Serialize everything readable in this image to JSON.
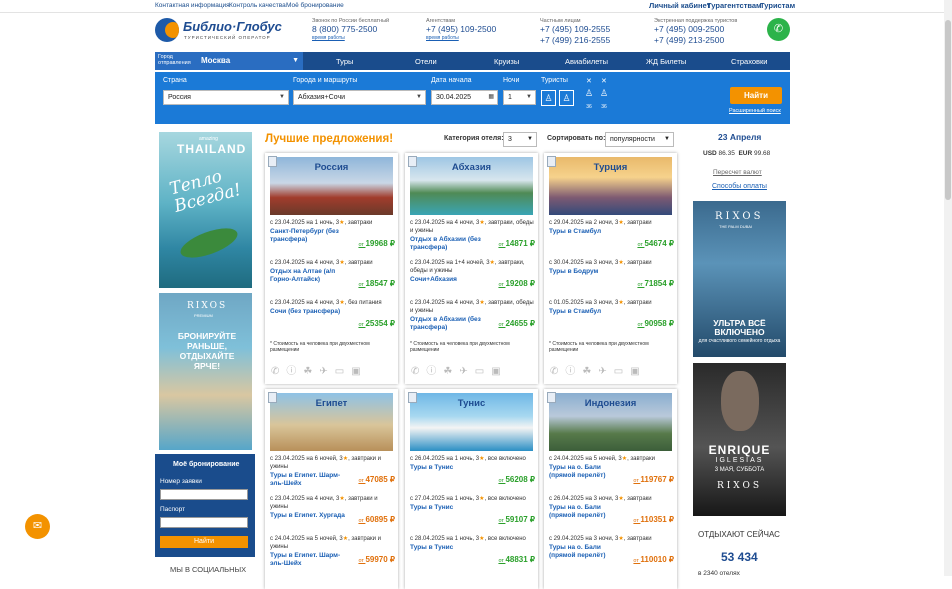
{
  "topbar": {
    "left": [
      "Контактная информация",
      "Контроль качества",
      "Моё бронирование"
    ],
    "right": [
      "Личный кабинет",
      "Турагентствам",
      "Туристам"
    ]
  },
  "logo": {
    "name": "Библио·Глобус",
    "sub": "ТУРИСТИЧЕСКИЙ ОПЕРАТОР"
  },
  "phones": [
    {
      "caption": "Звонок по России бесплатный",
      "nums": [
        "8 (800) 775-2500"
      ],
      "link": "время работы"
    },
    {
      "caption": "Агентствам",
      "nums": [
        "+7 (495) 109-2500"
      ],
      "link": "время работы"
    },
    {
      "caption": "Частным лицам",
      "nums": [
        "+7 (495) 109-2555",
        "+7 (499) 216-2555"
      ],
      "link": ""
    },
    {
      "caption": "Экстренная поддержка туристов",
      "nums": [
        "+7 (495) 009-2500",
        "+7 (499) 213-2500"
      ],
      "link": ""
    }
  ],
  "nav": {
    "city_label": "Город отправления",
    "city": "Москва",
    "items": [
      "Туры",
      "Отели",
      "Круизы",
      "Авиабилеты",
      "ЖД Билеты",
      "Страховки"
    ]
  },
  "search": {
    "country_label": "Страна",
    "country": "Россия",
    "city_label": "Города и маршруты",
    "city": "Абхазия+Сочи",
    "date_label": "Дата начала",
    "date": "30.04.2025",
    "nights_label": "Ночи",
    "nights": "1",
    "tourists_label": "Туристы",
    "kid_age_1": "36",
    "kid_age_2": "36",
    "find": "Найти",
    "advanced": "Расширенный поиск"
  },
  "best": {
    "title": "Лучшие предложения!",
    "cat_label": "Категория отеля:",
    "cat": "3",
    "sort_label": "Сортировать по:",
    "sort": "популярности"
  },
  "cards": [
    {
      "title": "Россия",
      "offers": [
        {
          "date": "с 23.04.2025",
          "nights": "на 1 ночь,",
          "stars": "3",
          "meal": "завтраки",
          "name": "Санкт-Петербург (без трансфера)",
          "from": "от",
          "price": "19968"
        },
        {
          "date": "с 23.04.2025",
          "nights": "на 4 ночи,",
          "stars": "3",
          "meal": "завтраки",
          "name": "Отдых на Алтае (а/п Горно-Алтайск)",
          "from": "от",
          "price": "18547"
        },
        {
          "date": "с 23.04.2025",
          "nights": "на 4 ночи,",
          "stars": "3",
          "meal": "без питания",
          "name": "Сочи (без трансфера)",
          "from": "от",
          "price": "25354"
        }
      ],
      "note": "Стоимость на человека при двухместном размещении"
    },
    {
      "title": "Абхазия",
      "offers": [
        {
          "date": "с 23.04.2025",
          "nights": "на 4 ночи,",
          "stars": "3",
          "meal": "завтраки, обеды и ужины",
          "name": "Отдых в Абхазии (без трансфера)",
          "from": "от",
          "price": "14871"
        },
        {
          "date": "с 23.04.2025",
          "nights": "на 1+4 ночей,",
          "stars": "3",
          "meal": "завтраки, обеды и ужины",
          "name": "Сочи+Абхазия",
          "from": "от",
          "price": "19208"
        },
        {
          "date": "с 23.04.2025",
          "nights": "на 4 ночи,",
          "stars": "3",
          "meal": "завтраки, обеды и ужины",
          "name": "Отдых в Абхазии (без трансфера)",
          "from": "от",
          "price": "24655"
        }
      ],
      "note": "Стоимость на человека при двухместном размещении"
    },
    {
      "title": "Турция",
      "offers": [
        {
          "date": "с 29.04.2025",
          "nights": "на 2 ночи,",
          "stars": "3",
          "meal": "завтраки",
          "name": "Туры в Стамбул",
          "from": "от",
          "price": "54674"
        },
        {
          "date": "с 30.04.2025",
          "nights": "на 3 ночи,",
          "stars": "3",
          "meal": "завтраки",
          "name": "Туры в Бодрум",
          "from": "от",
          "price": "71854"
        },
        {
          "date": "с 01.05.2025",
          "nights": "на 3 ночи,",
          "stars": "3",
          "meal": "завтраки",
          "name": "Туры в Стамбул",
          "from": "от",
          "price": "90958"
        }
      ],
      "note": "Стоимость на человека при двухместном размещении"
    },
    {
      "title": "Египет",
      "offers": [
        {
          "date": "с 23.04.2025",
          "nights": "на 6 ночей,",
          "stars": "3",
          "meal": "завтраки и ужины",
          "name": "Туры в Египет. Шарм-эль-Шейх",
          "from": "от",
          "price": "47085"
        },
        {
          "date": "с 23.04.2025",
          "nights": "на 4 ночи,",
          "stars": "3",
          "meal": "завтраки и ужины",
          "name": "Туры в Египет. Хургада",
          "from": "от",
          "price": "60895"
        },
        {
          "date": "с 24.04.2025",
          "nights": "на 5 ночей,",
          "stars": "3",
          "meal": "завтраки и ужины",
          "name": "Туры в Египет. Шарм-эль-Шейх",
          "from": "от",
          "price": "59970"
        }
      ],
      "note": ""
    },
    {
      "title": "Тунис",
      "offers": [
        {
          "date": "с 26.04.2025",
          "nights": "на 1 ночь,",
          "stars": "3",
          "meal": "все включено",
          "name": "Туры в Тунис",
          "from": "от",
          "price": "56208"
        },
        {
          "date": "с 27.04.2025",
          "nights": "на 1 ночь,",
          "stars": "3",
          "meal": "все включено",
          "name": "Туры в Тунис",
          "from": "от",
          "price": "59107"
        },
        {
          "date": "с 28.04.2025",
          "nights": "на 1 ночь,",
          "stars": "3",
          "meal": "все включено",
          "name": "Туры в Тунис",
          "from": "от",
          "price": "48831"
        }
      ],
      "note": ""
    },
    {
      "title": "Индонезия",
      "offers": [
        {
          "date": "с 24.04.2025",
          "nights": "на 5 ночей,",
          "stars": "3",
          "meal": "завтраки",
          "name": "Туры на о. Бали (прямой перелёт)",
          "from": "от",
          "price": "119767"
        },
        {
          "date": "с 26.04.2025",
          "nights": "на 3 ночи,",
          "stars": "3",
          "meal": "завтраки",
          "name": "Туры на о. Бали (прямой перелёт)",
          "from": "от",
          "price": "110351"
        },
        {
          "date": "с 29.04.2025",
          "nights": "на 3 ночи,",
          "stars": "3",
          "meal": "завтраки",
          "name": "Туры на о. Бали (прямой перелёт)",
          "from": "от",
          "price": "110010"
        }
      ],
      "note": ""
    }
  ],
  "right": {
    "date": "23 Апреля",
    "usd_label": "USD",
    "usd": "86.35",
    "eur_label": "EUR",
    "eur": "99.68",
    "recalc": "Пересчет валют",
    "pay": "Способы оплаты",
    "resting_label": "ОТДЫХАЮТ СЕЙЧАС",
    "resting": "53 434",
    "hotels": "в 2340 отелях"
  },
  "banners": {
    "thai_small": "amazing",
    "thai": "THAILAND",
    "thai_slogan": "Тепло Всегда!",
    "rixos1": "RIXOS",
    "rixos1_sub": "PREMIUM",
    "rixos1_text": "БРОНИРУЙТЕ РАНЬШЕ, ОТДЫХАЙТЕ ЯРЧЕ!",
    "rixos2": "RIXOS",
    "rixos2_sub": "THE PALM DUBAI",
    "rixos2_text": "УЛЬТРА ВСЁ ВКЛЮЧЕНО",
    "rixos2_sub2": "для счастливого семейного отдыха",
    "enrique1": "ENRIQUE",
    "enrique2": "IGLESIAS",
    "enrique3": "3 МАЯ, СУББОТА",
    "rixos3": "RIXOS"
  },
  "booking": {
    "title": "Моё бронирование",
    "req": "Номер заявки",
    "pass": "Паспорт",
    "btn": "Найти"
  },
  "social": "МЫ В СОЦИАЛЬНЫХ",
  "icons": {
    "call": "phone-icon",
    "chat": "chat-icon"
  },
  "colors": {
    "brand": "#1a4c8c",
    "accent": "#f39200",
    "search": "#1b7ad7",
    "price": "#2aa02a"
  }
}
